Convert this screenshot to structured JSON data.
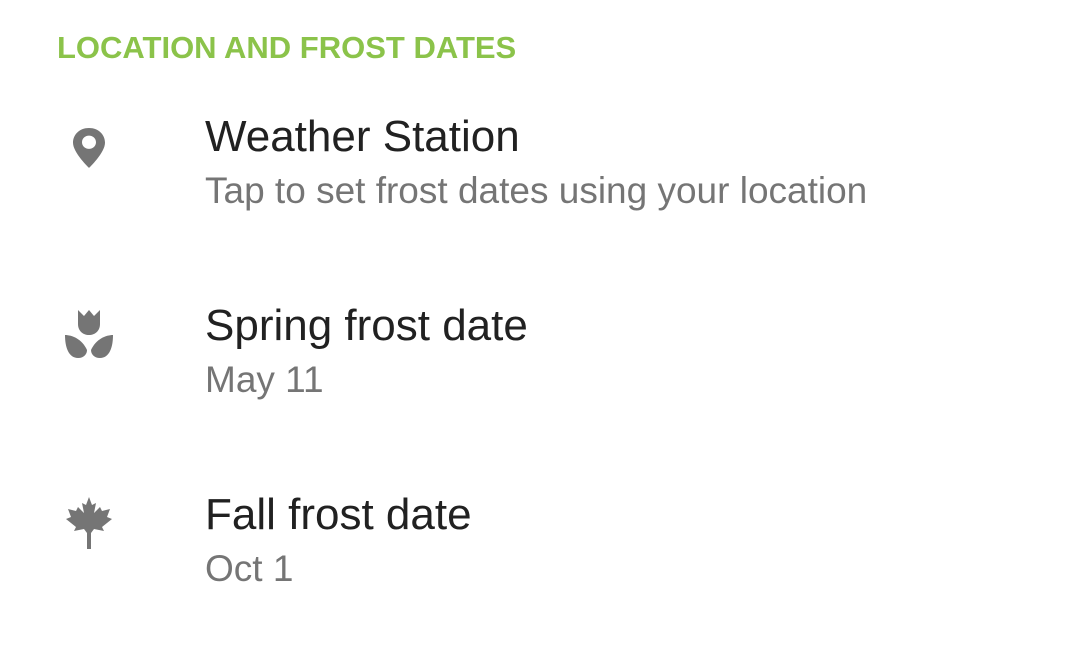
{
  "section": {
    "header": "LOCATION AND FROST DATES",
    "accent_color": "#8bc34a"
  },
  "items": [
    {
      "icon": "location-pin-icon",
      "title": "Weather Station",
      "summary": "Tap to set frost dates using your location"
    },
    {
      "icon": "tulip-icon",
      "title": "Spring frost date",
      "summary": "May 11"
    },
    {
      "icon": "maple-leaf-icon",
      "title": "Fall frost date",
      "summary": "Oct 1"
    }
  ],
  "colors": {
    "title": "#212121",
    "summary": "#757575",
    "icon": "#757575"
  }
}
